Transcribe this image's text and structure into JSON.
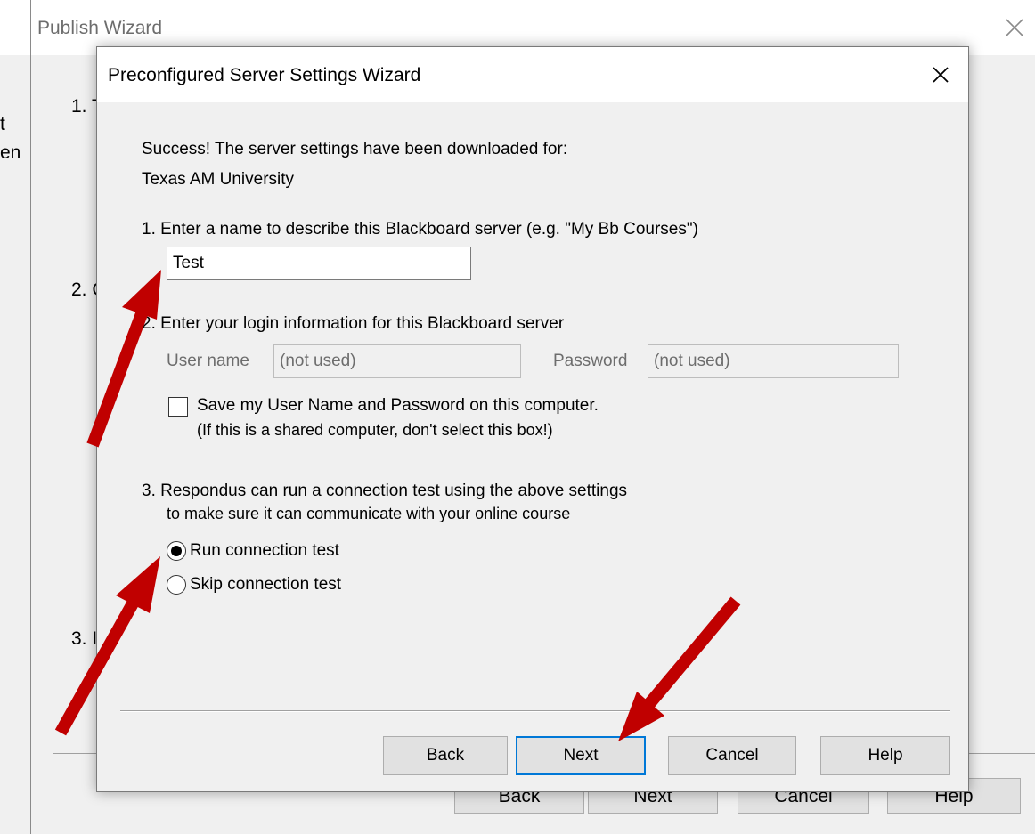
{
  "parent_window": {
    "title": "Publish Wizard",
    "fragments": [
      "1. T",
      "t",
      "en",
      "2. C",
      "3. I"
    ],
    "buttons": [
      "Back",
      "Next",
      "Cancel",
      "Help"
    ]
  },
  "dialog": {
    "title": "Preconfigured Server Settings Wizard",
    "success_line1": "Success! The server settings have been downloaded for:",
    "success_line2": "Texas AM University",
    "step1": {
      "label": "1.  Enter a name to describe this Blackboard server (e.g. \"My Bb Courses\")",
      "value": "Test"
    },
    "step2": {
      "label": "2.  Enter your login information for this Blackboard server",
      "username_label": "User name",
      "username_value": "(not used)",
      "password_label": "Password",
      "password_value": "(not used)",
      "save_line1": "Save my User Name and Password on this computer.",
      "save_line2": "(If this is a shared computer, don't select this box!)",
      "save_checked": false
    },
    "step3": {
      "label_line1": "3.  Respondus can run a connection test using the above settings",
      "label_line2": "to make sure it can communicate with your online course",
      "options": [
        "Run connection test",
        "Skip connection test"
      ],
      "selected": "Run connection test"
    },
    "buttons": {
      "back": "Back",
      "next": "Next",
      "cancel": "Cancel",
      "help": "Help"
    }
  },
  "annotation_color": "#c00000"
}
